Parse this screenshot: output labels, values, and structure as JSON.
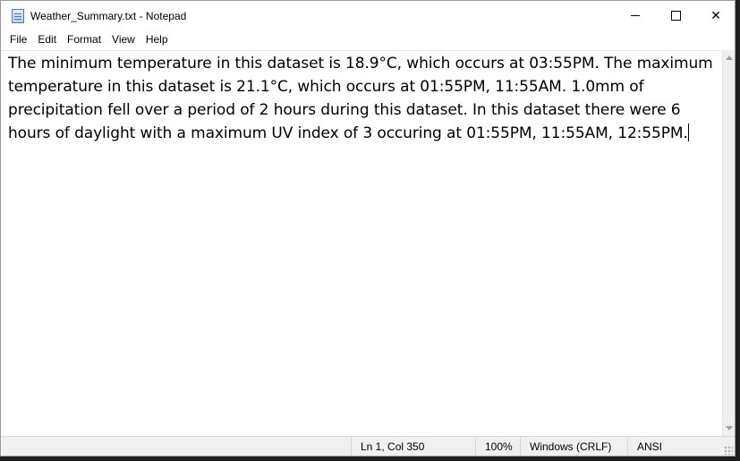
{
  "window": {
    "title": "Weather_Summary.txt - Notepad",
    "app_icon": "notepad-icon"
  },
  "window_controls": {
    "minimize_icon": "minimize-icon",
    "maximize_icon": "maximize-icon",
    "close_icon": "close-icon",
    "close_glyph": "✕"
  },
  "menu": {
    "items": [
      "File",
      "Edit",
      "Format",
      "View",
      "Help"
    ]
  },
  "editor": {
    "content": "The minimum temperature in this dataset is 18.9°C, which occurs at 03:55PM. The maximum temperature in this dataset is 21.1°C, which occurs at 01:55PM, 11:55AM. 1.0mm of precipitation fell over a period of 2 hours during this dataset. In this dataset there were 6 hours of daylight with a maximum UV index of 3 occuring at 01:55PM, 11:55AM, 12:55PM."
  },
  "statusbar": {
    "position": "Ln 1, Col 350",
    "zoom": "100%",
    "line_ending": "Windows (CRLF)",
    "encoding": "ANSI"
  }
}
